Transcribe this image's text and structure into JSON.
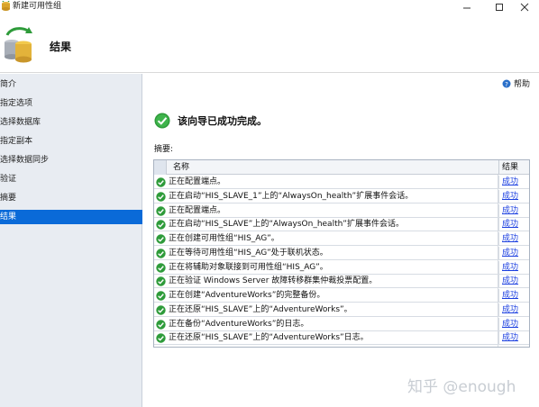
{
  "window": {
    "title": "新建可用性组",
    "controls": {
      "minimize": "—",
      "maximize": "☐",
      "close": "✕"
    }
  },
  "header": {
    "title": "结果"
  },
  "nav": {
    "items": [
      {
        "label": "简介"
      },
      {
        "label": "指定选项"
      },
      {
        "label": "选择数据库"
      },
      {
        "label": "指定副本"
      },
      {
        "label": "选择数据同步"
      },
      {
        "label": "验证"
      },
      {
        "label": "摘要"
      },
      {
        "label": "结果",
        "active": true
      }
    ]
  },
  "main": {
    "help_label": "帮助",
    "success_message": "该向导已成功完成。",
    "summary_label": "摘要:",
    "table": {
      "columns": {
        "name": "名称",
        "result": "结果"
      },
      "rows": [
        {
          "name": "正在配置端点。",
          "result": "成功"
        },
        {
          "name": "正在启动“HIS_SLAVE_1”上的“AlwaysOn_health”扩展事件会话。",
          "result": "成功"
        },
        {
          "name": "正在配置端点。",
          "result": "成功"
        },
        {
          "name": "正在启动“HIS_SLAVE”上的“AlwaysOn_health”扩展事件会话。",
          "result": "成功"
        },
        {
          "name": "正在创建可用性组“HIS_AG”。",
          "result": "成功"
        },
        {
          "name": "正在等待可用性组“HIS_AG”处于联机状态。",
          "result": "成功"
        },
        {
          "name": "正在将辅助对象联接到可用性组“HIS_AG”。",
          "result": "成功"
        },
        {
          "name": "正在验证 Windows Server 故障转移群集仲裁投票配置。",
          "result": "成功"
        },
        {
          "name": "正在创建“AdventureWorks”的完整备份。",
          "result": "成功"
        },
        {
          "name": "正在还原“HIS_SLAVE”上的“AdventureWorks”。",
          "result": "成功"
        },
        {
          "name": "正在备份“AdventureWorks”的日志。",
          "result": "成功"
        },
        {
          "name": "正在还原“HIS_SLAVE”上的“AdventureWorks”日志。",
          "result": "成功"
        }
      ]
    }
  },
  "watermark": "知乎 @enough",
  "colors": {
    "nav_bg": "#e8ecf2",
    "nav_active": "#0a6ad8",
    "link": "#1a3ee0",
    "success_green": "#2e9b3a"
  },
  "icons": {
    "app": "availability-group-icon",
    "header": "database-cluster-icon",
    "help": "help-icon",
    "status": "success-check-icon"
  }
}
